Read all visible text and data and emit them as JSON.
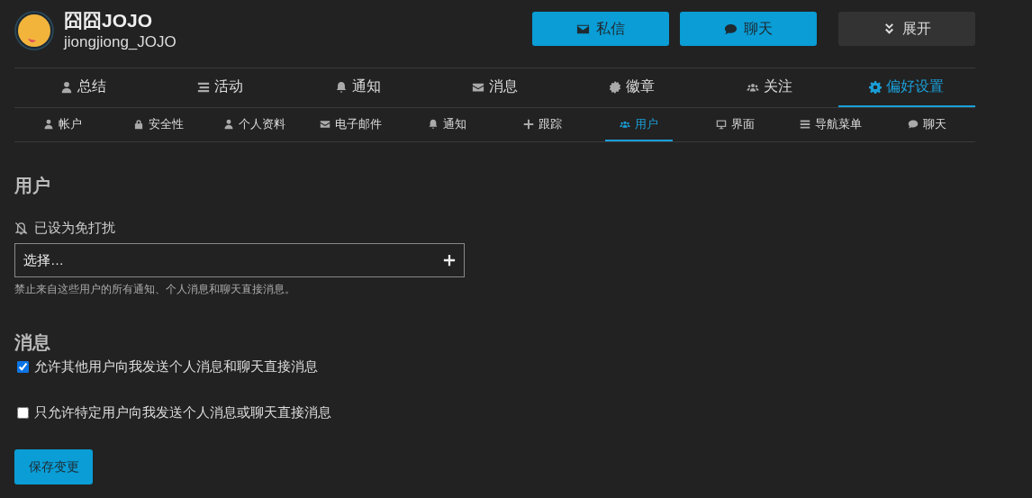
{
  "profile": {
    "display_name": "囧囧JOJO",
    "username": "jiongjiong_JOJO"
  },
  "header_buttons": [
    {
      "label": "私信",
      "kind": "primary"
    },
    {
      "label": "聊天",
      "kind": "primary"
    },
    {
      "label": "展开",
      "kind": "secondary"
    }
  ],
  "main_tabs": [
    {
      "label": "总结",
      "selected": false
    },
    {
      "label": "活动",
      "selected": false
    },
    {
      "label": "通知",
      "selected": false
    },
    {
      "label": "消息",
      "selected": false
    },
    {
      "label": "徽章",
      "selected": false
    },
    {
      "label": "关注",
      "selected": false
    },
    {
      "label": "偏好设置",
      "selected": true
    }
  ],
  "sub_tabs": [
    {
      "label": "帐户",
      "selected": false
    },
    {
      "label": "安全性",
      "selected": false
    },
    {
      "label": "个人资料",
      "selected": false
    },
    {
      "label": "电子邮件",
      "selected": false
    },
    {
      "label": "通知",
      "selected": false
    },
    {
      "label": "跟踪",
      "selected": false
    },
    {
      "label": "用户",
      "selected": true
    },
    {
      "label": "界面",
      "selected": false
    },
    {
      "label": "导航菜单",
      "selected": false
    },
    {
      "label": "聊天",
      "selected": false
    }
  ],
  "users_section": {
    "heading": "用户",
    "muted_label": "已设为免打扰",
    "select_placeholder": "选择…",
    "hint": "禁止来自这些用户的所有通知、个人消息和聊天直接消息。"
  },
  "messages_section": {
    "heading": "消息",
    "options": [
      {
        "label": "允许其他用户向我发送个人消息和聊天直接消息",
        "checked": true
      },
      {
        "label": "只允许特定用户向我发送个人消息或聊天直接消息",
        "checked": false
      }
    ]
  },
  "save_button": "保存变更"
}
